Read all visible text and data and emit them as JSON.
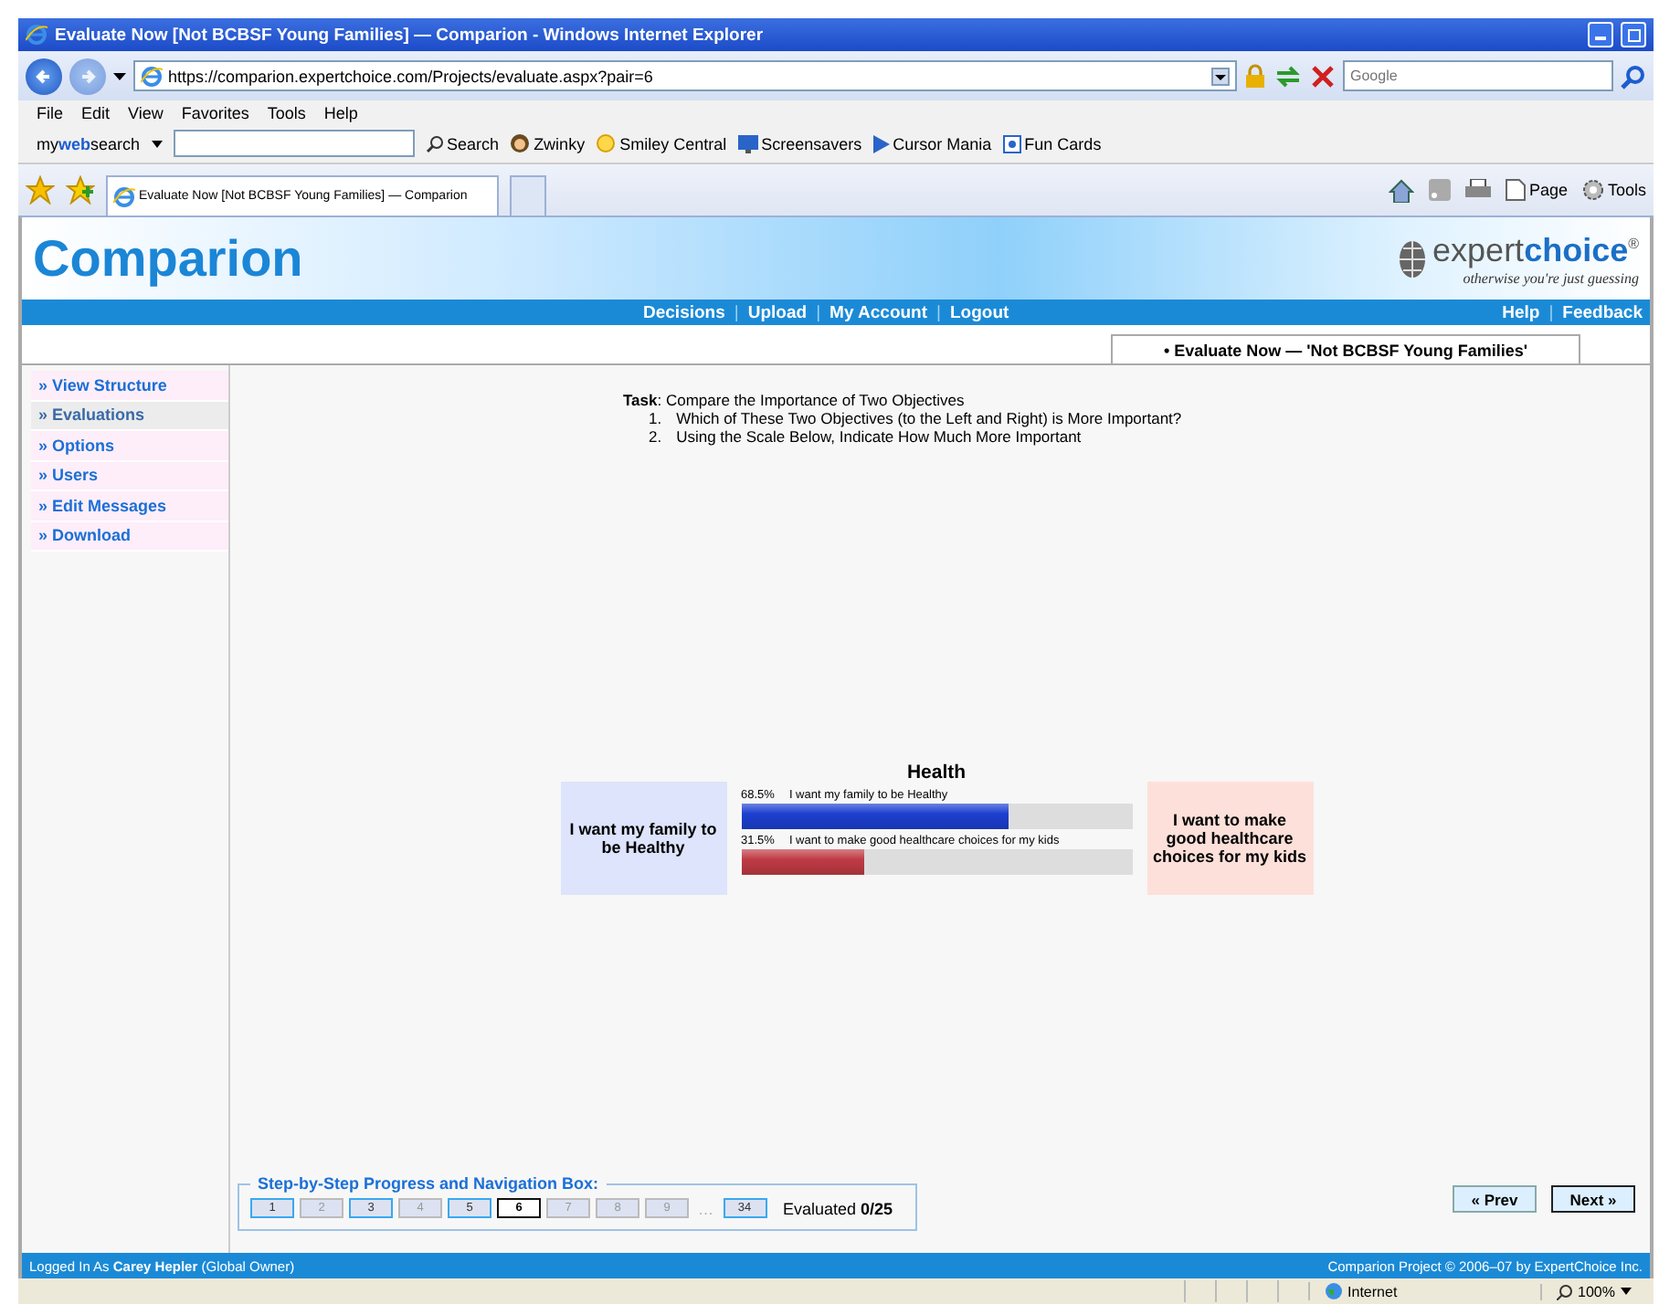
{
  "window": {
    "title": "Evaluate Now [Not BCBSF Young Families] — Comparion - Windows Internet Explorer"
  },
  "browser": {
    "address": "https://comparion.expertchoice.com/Projects/evaluate.aspx?pair=6",
    "search_placeholder": "Google",
    "menu": [
      "File",
      "Edit",
      "View",
      "Favorites",
      "Tools",
      "Help"
    ],
    "toolbar_brand": "my**web**search",
    "toolbar_links": [
      "Search",
      "Zwinky",
      "Smiley Central",
      "Screensavers",
      "Cursor Mania",
      "Fun Cards"
    ],
    "tab": "Evaluate Now [Not BCBSF Young Families] — Comparion",
    "commands": [
      "Page",
      "Tools"
    ]
  },
  "app": {
    "logo": "Comparion",
    "brand": "expert**choice**$^{®}$",
    "tagline": "otherwise you're just guessing",
    "nav": [
      {
        "kind": "link",
        "label": "Decisions"
      },
      {
        "kind": "separator",
        "label": "|"
      },
      {
        "kind": "link",
        "label": "Upload"
      },
      {
        "kind": "separator",
        "label": "|"
      },
      {
        "kind": "link",
        "label": "My Account"
      },
      {
        "kind": "separator",
        "label": "|"
      },
      {
        "kind": "link",
        "label": "Logout"
      }
    ],
    "nav_right": [
      {
        "kind": "link",
        "label": "Help"
      },
      {
        "kind": "separator",
        "label": "|"
      },
      {
        "kind": "link",
        "label": "Feedback"
      }
    ],
    "page_tab": "• Evaluate Now — 'Not BCBSF Young Families'"
  },
  "sidebar": {
    "items": [
      {
        "label": "» View Structure",
        "selected": false
      },
      {
        "label": "» Evaluations",
        "selected": true
      },
      {
        "label": "» Options",
        "selected": false
      },
      {
        "label": "» Users",
        "selected": false
      },
      {
        "label": "» Edit Messages",
        "selected": false
      },
      {
        "label": "» Download",
        "selected": false
      }
    ]
  },
  "task": {
    "text": "**Task**: Compare the Importance of Two Objectives",
    "steps": [
      {
        "number": "1.",
        "text": "Which of These Two Objectives (to the Left and Right) is More Important?"
      },
      {
        "number": "2.",
        "text": "Using the Scale Below, Indicate How Much More Important"
      }
    ]
  },
  "comparison": {
    "title": "Health",
    "left": "I want my family to be Healthy",
    "right": "I want to make good healthcare choices for my kids",
    "bars": [
      {
        "percent": "68.5%",
        "label": "I want my family to be Healthy",
        "level": 0.685,
        "color": "#1c3fd0"
      },
      {
        "percent": "31.5%",
        "label": "I want to make good healthcare choices for my kids",
        "level": 0.315,
        "color": "#c03a44"
      }
    ]
  },
  "progress": {
    "legend": "Step-by-Step Progress and Navigation Box:",
    "steps": [
      {
        "label": "1",
        "evaluated": true,
        "selected": false
      },
      {
        "label": "2",
        "evaluated": false,
        "selected": false
      },
      {
        "label": "3",
        "evaluated": true,
        "selected": false
      },
      {
        "label": "4",
        "evaluated": false,
        "selected": false
      },
      {
        "label": "5",
        "evaluated": true,
        "selected": false
      },
      {
        "label": "6",
        "evaluated": false,
        "selected": true
      },
      {
        "label": "7",
        "evaluated": false,
        "selected": false
      },
      {
        "label": "8",
        "evaluated": false,
        "selected": false
      },
      {
        "label": "9",
        "evaluated": false,
        "selected": false
      }
    ],
    "ellipsis": "…",
    "last": {
      "label": "34",
      "evaluated": true,
      "selected": false
    },
    "status": "Evaluated **0/25**"
  },
  "buttons": {
    "prev": "« Prev",
    "next": "Next »"
  },
  "footer": {
    "left": "Logged In As **Carey Hepler** (Global Owner)",
    "right": "Comparion Project © 2006–07 by ExpertChoice Inc."
  },
  "status_bar": {
    "zone": "Internet",
    "zoom": "100%"
  }
}
